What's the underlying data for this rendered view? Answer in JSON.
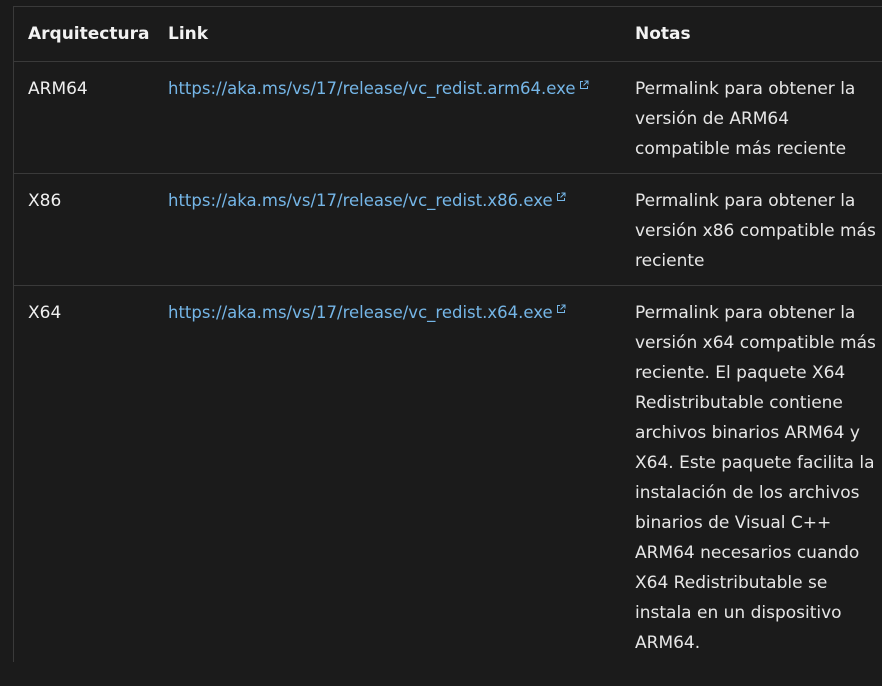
{
  "table": {
    "headers": [
      "Arquitectura",
      "Link",
      "Notas"
    ],
    "rows": [
      {
        "arch": "ARM64",
        "link": "https://aka.ms/vs/17/release/vc_redist.arm64.exe",
        "notes": "Permalink para obtener la versión de ARM64 compatible más reciente"
      },
      {
        "arch": "X86",
        "link": "https://aka.ms/vs/17/release/vc_redist.x86.exe",
        "notes": "Permalink para obtener la versión x86 compatible más reciente"
      },
      {
        "arch": "X64",
        "link": "https://aka.ms/vs/17/release/vc_redist.x64.exe",
        "notes": "Permalink para obtener la versión x64 compatible más reciente. El paquete X64 Redistributable contiene archivos binarios ARM64 y X64. Este paquete facilita la instalación de los archivos binarios de Visual C++ ARM64 necesarios cuando X64 Redistributable se instala en un dispositivo ARM64."
      }
    ]
  },
  "colors": {
    "background": "#1b1b1b",
    "link": "#75b6e7",
    "border": "#3a3a3a"
  },
  "icons": {
    "link_icon": "external-link-icon"
  }
}
